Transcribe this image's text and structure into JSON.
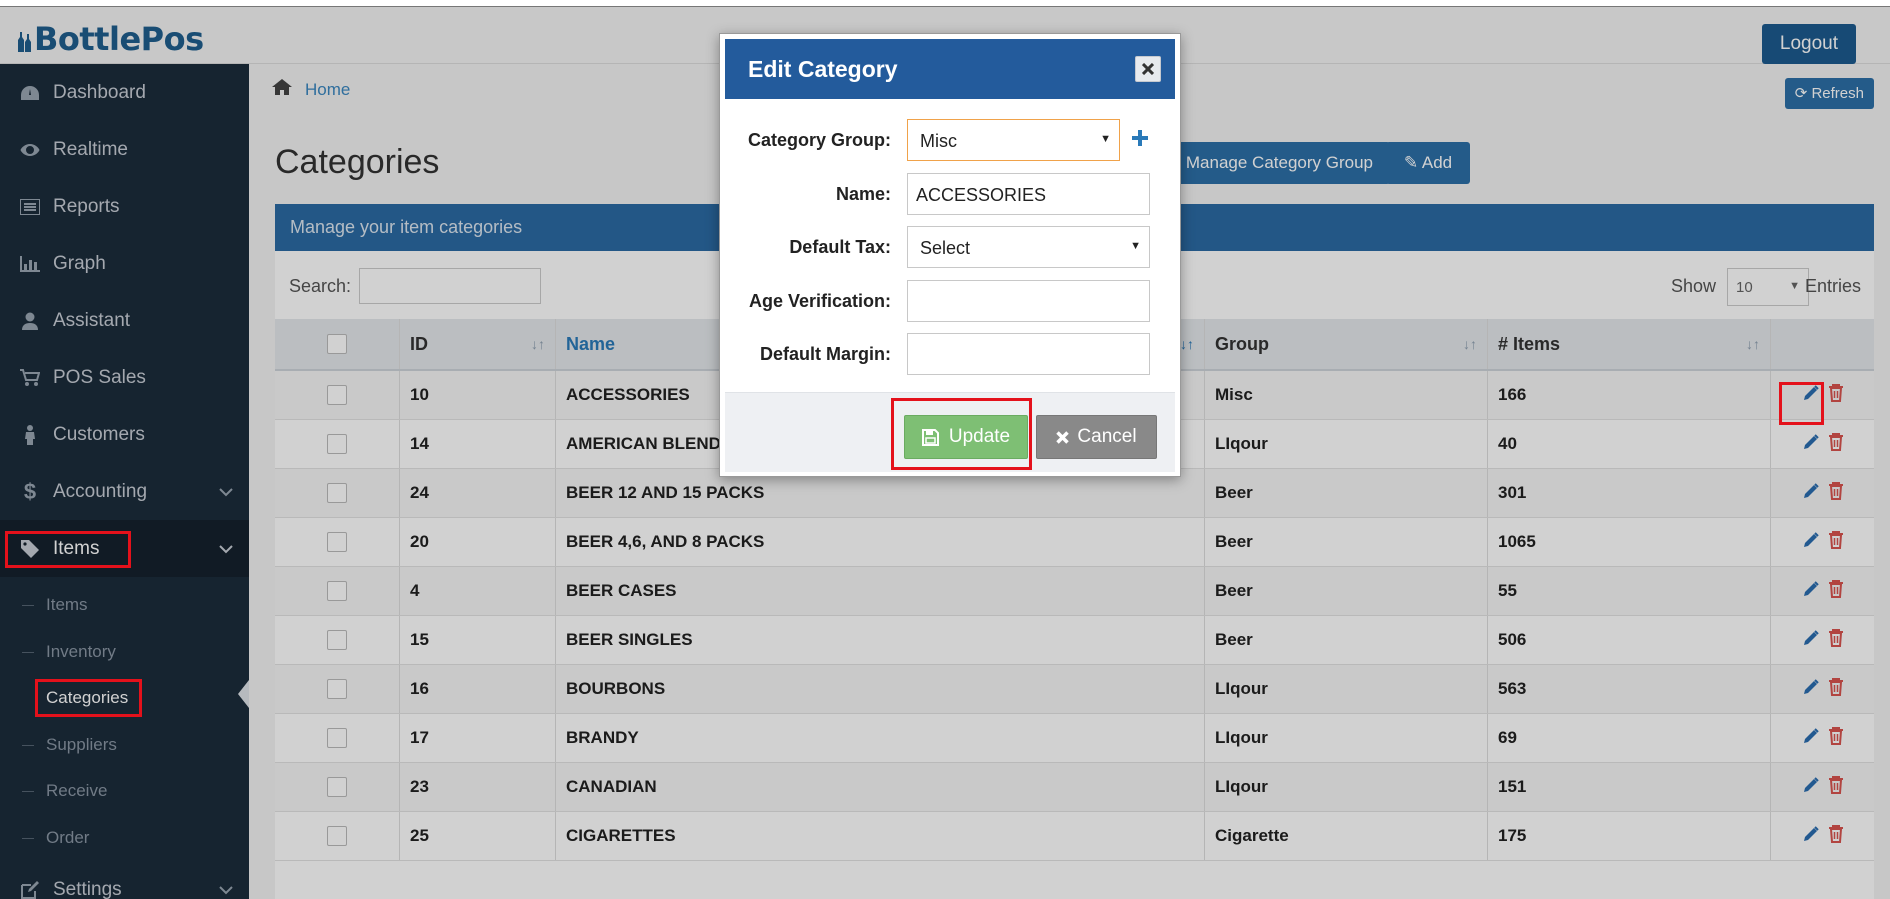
{
  "app": {
    "logo": "BottlePos",
    "logout_label": "Logout"
  },
  "sidebar": {
    "items": [
      {
        "label": "Dashboard",
        "icon": "dashboard-icon"
      },
      {
        "label": "Realtime",
        "icon": "eye-icon"
      },
      {
        "label": "Reports",
        "icon": "list-icon"
      },
      {
        "label": "Graph",
        "icon": "bar-chart-icon"
      },
      {
        "label": "Assistant",
        "icon": "user-icon"
      },
      {
        "label": "POS Sales",
        "icon": "cart-icon"
      },
      {
        "label": "Customers",
        "icon": "person-icon"
      },
      {
        "label": "Accounting",
        "icon": "dollar-icon"
      },
      {
        "label": "Items",
        "icon": "tag-icon"
      },
      {
        "label": "Settings",
        "icon": "edit-icon"
      }
    ],
    "sub_items": [
      "Items",
      "Inventory",
      "Categories",
      "Suppliers",
      "Receive",
      "Order"
    ]
  },
  "breadcrumb": {
    "home": "Home"
  },
  "toolbar": {
    "refresh_label": "Refresh",
    "manage_group_label": "Manage Category Group",
    "add_label": "Add"
  },
  "page": {
    "title": "Categories",
    "panel_title": "Manage your item categories",
    "search_label": "Search:",
    "show_label": "Show",
    "entries_value": "10",
    "entries_label": "Entries"
  },
  "table": {
    "headers": {
      "id": "ID",
      "name": "Name",
      "group": "Group",
      "items": "# Items"
    },
    "rows": [
      {
        "id": "10",
        "name": "ACCESSORIES",
        "group": "Misc",
        "items": "166"
      },
      {
        "id": "14",
        "name": "AMERICAN BLEND",
        "group": "LIqour",
        "items": "40"
      },
      {
        "id": "24",
        "name": "BEER 12 AND 15 PACKS",
        "group": "Beer",
        "items": "301"
      },
      {
        "id": "20",
        "name": "BEER 4,6, AND 8 PACKS",
        "group": "Beer",
        "items": "1065"
      },
      {
        "id": "4",
        "name": "BEER CASES",
        "group": "Beer",
        "items": "55"
      },
      {
        "id": "15",
        "name": "BEER SINGLES",
        "group": "Beer",
        "items": "506"
      },
      {
        "id": "16",
        "name": "BOURBONS",
        "group": "LIqour",
        "items": "563"
      },
      {
        "id": "17",
        "name": "BRANDY",
        "group": "LIqour",
        "items": "69"
      },
      {
        "id": "23",
        "name": "CANADIAN",
        "group": "LIqour",
        "items": "151"
      },
      {
        "id": "25",
        "name": "CIGARETTES",
        "group": "Cigarette",
        "items": "175"
      }
    ]
  },
  "modal": {
    "title": "Edit Category",
    "fields": {
      "category_group_label": "Category Group:",
      "category_group_value": "Misc",
      "name_label": "Name:",
      "name_value": "ACCESSORIES",
      "default_tax_label": "Default Tax:",
      "default_tax_value": "Select",
      "age_verification_label": "Age Verification:",
      "age_verification_value": "",
      "default_margin_label": "Default Margin:",
      "default_margin_value": ""
    },
    "update_label": "Update",
    "cancel_label": "Cancel"
  },
  "colors": {
    "sidebar_bg": "#1b2c3b",
    "primary": "#2b6ba4",
    "modal_header": "#235b9c",
    "update_green": "#7ebf74",
    "cancel_gray": "#898989",
    "highlight_red": "#e4111b",
    "delete_red": "#d9534f"
  }
}
